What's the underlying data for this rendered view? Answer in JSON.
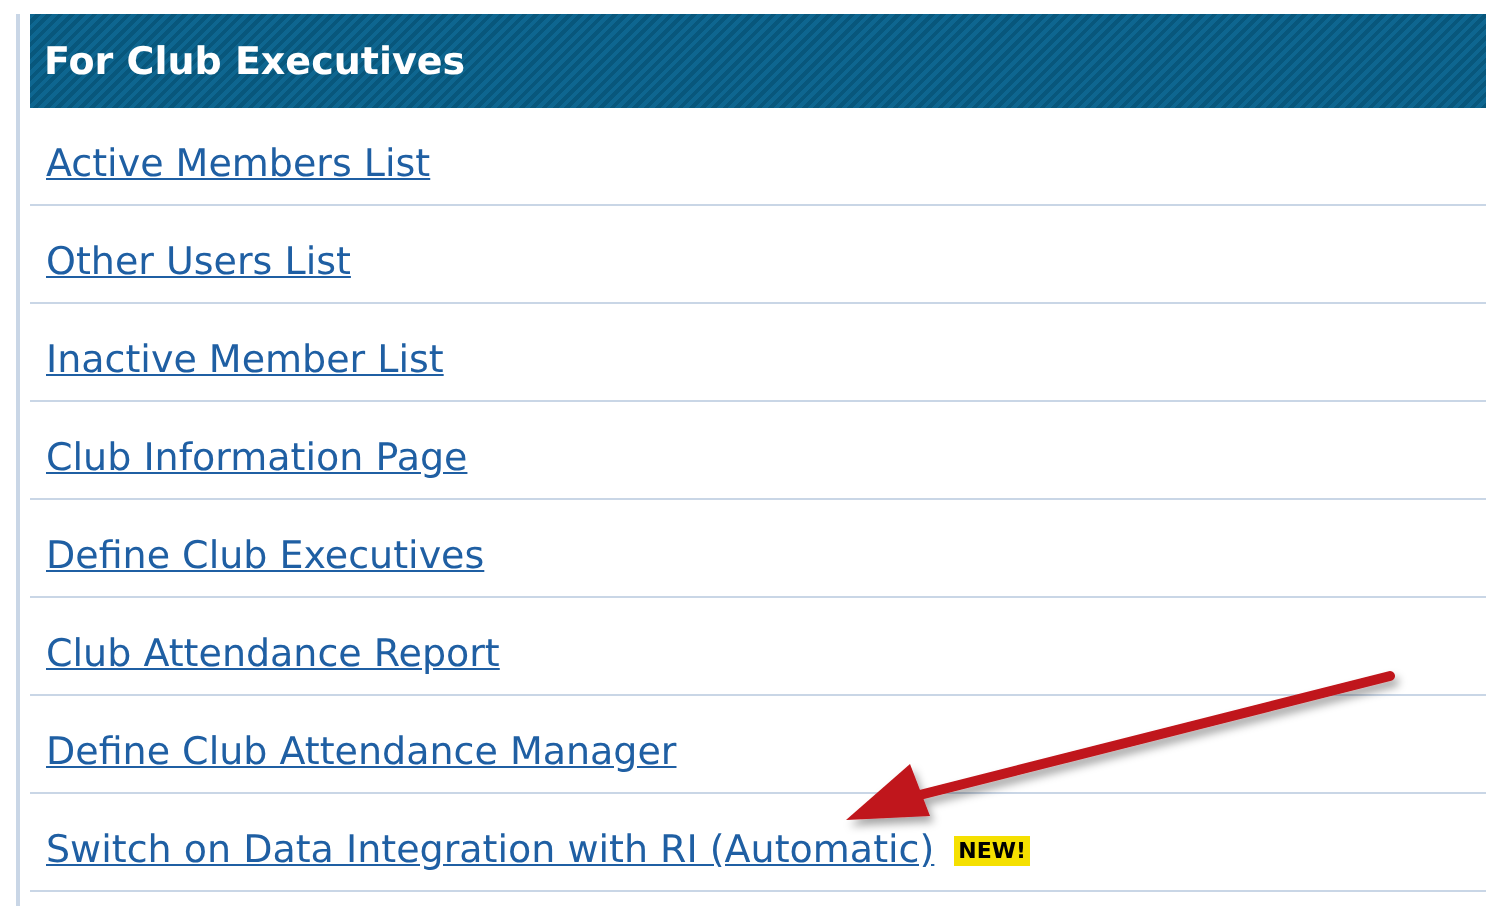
{
  "panel": {
    "title": "For Club Executives",
    "links": [
      {
        "label": "Active Members List"
      },
      {
        "label": "Other Users List"
      },
      {
        "label": "Inactive Member List"
      },
      {
        "label": "Club Information Page"
      },
      {
        "label": "Define Club Executives"
      },
      {
        "label": "Club Attendance Report"
      },
      {
        "label": "Define Club Attendance Manager"
      },
      {
        "label": "Switch on Data Integration with RI (Automatic)",
        "badge": "NEW!"
      }
    ]
  }
}
